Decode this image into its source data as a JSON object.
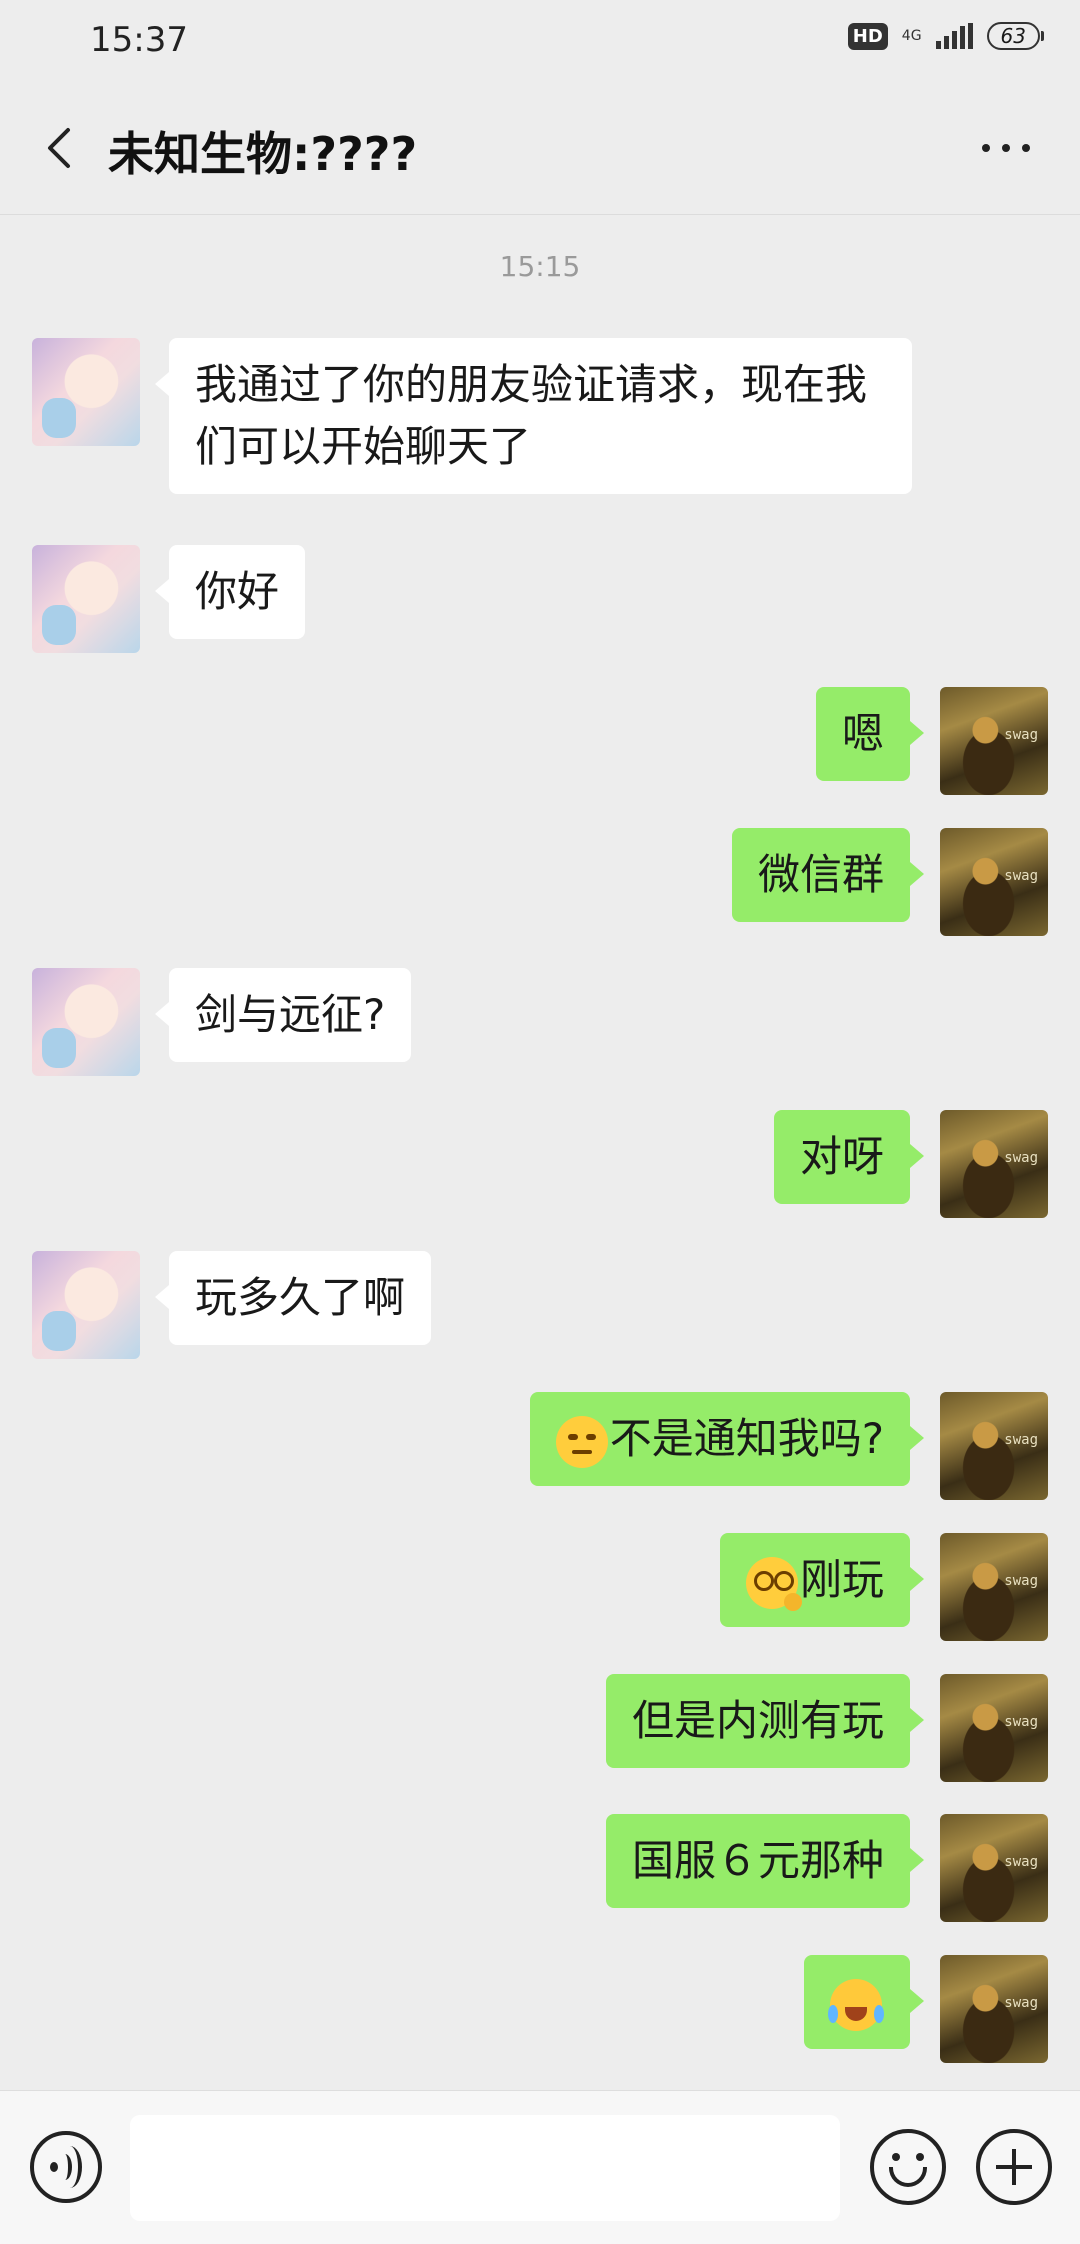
{
  "status_bar": {
    "time": "15:37",
    "hd": "HD",
    "network": "4G",
    "battery": "63"
  },
  "header": {
    "title": "未知生物:????",
    "back_icon": "chevron-left-icon",
    "more_icon": "more-dots-icon"
  },
  "messages": {
    "timestamp": "15:15",
    "items": [
      {
        "side": "in",
        "text": "我通过了你的朋友验证请求，现在我们可以开始聊天了"
      },
      {
        "side": "in",
        "text": "你好"
      },
      {
        "side": "out",
        "text": "嗯"
      },
      {
        "side": "out",
        "text": "微信群"
      },
      {
        "side": "in",
        "text": "剑与远征?"
      },
      {
        "side": "out",
        "text": "对呀"
      },
      {
        "side": "in",
        "text": "玩多久了啊"
      },
      {
        "side": "out",
        "emoji": "smirk-emoji",
        "text": "不是通知我吗?"
      },
      {
        "side": "out",
        "emoji": "dizzy-face-emoji",
        "text": "刚玩"
      },
      {
        "side": "out",
        "text": "但是内测有玩"
      },
      {
        "side": "out",
        "text": "国服６元那种"
      },
      {
        "side": "out",
        "emoji": "laugh-cry-emoji",
        "text": ""
      }
    ],
    "outgoing_avatar_text": "swag"
  },
  "input_bar": {
    "placeholder": "",
    "voice_icon": "voice-icon",
    "emoji_icon": "emoji-icon",
    "plus_icon": "plus-icon"
  },
  "colors": {
    "background": "#ededed",
    "outgoing_bubble": "#95ec69",
    "incoming_bubble": "#ffffff"
  }
}
